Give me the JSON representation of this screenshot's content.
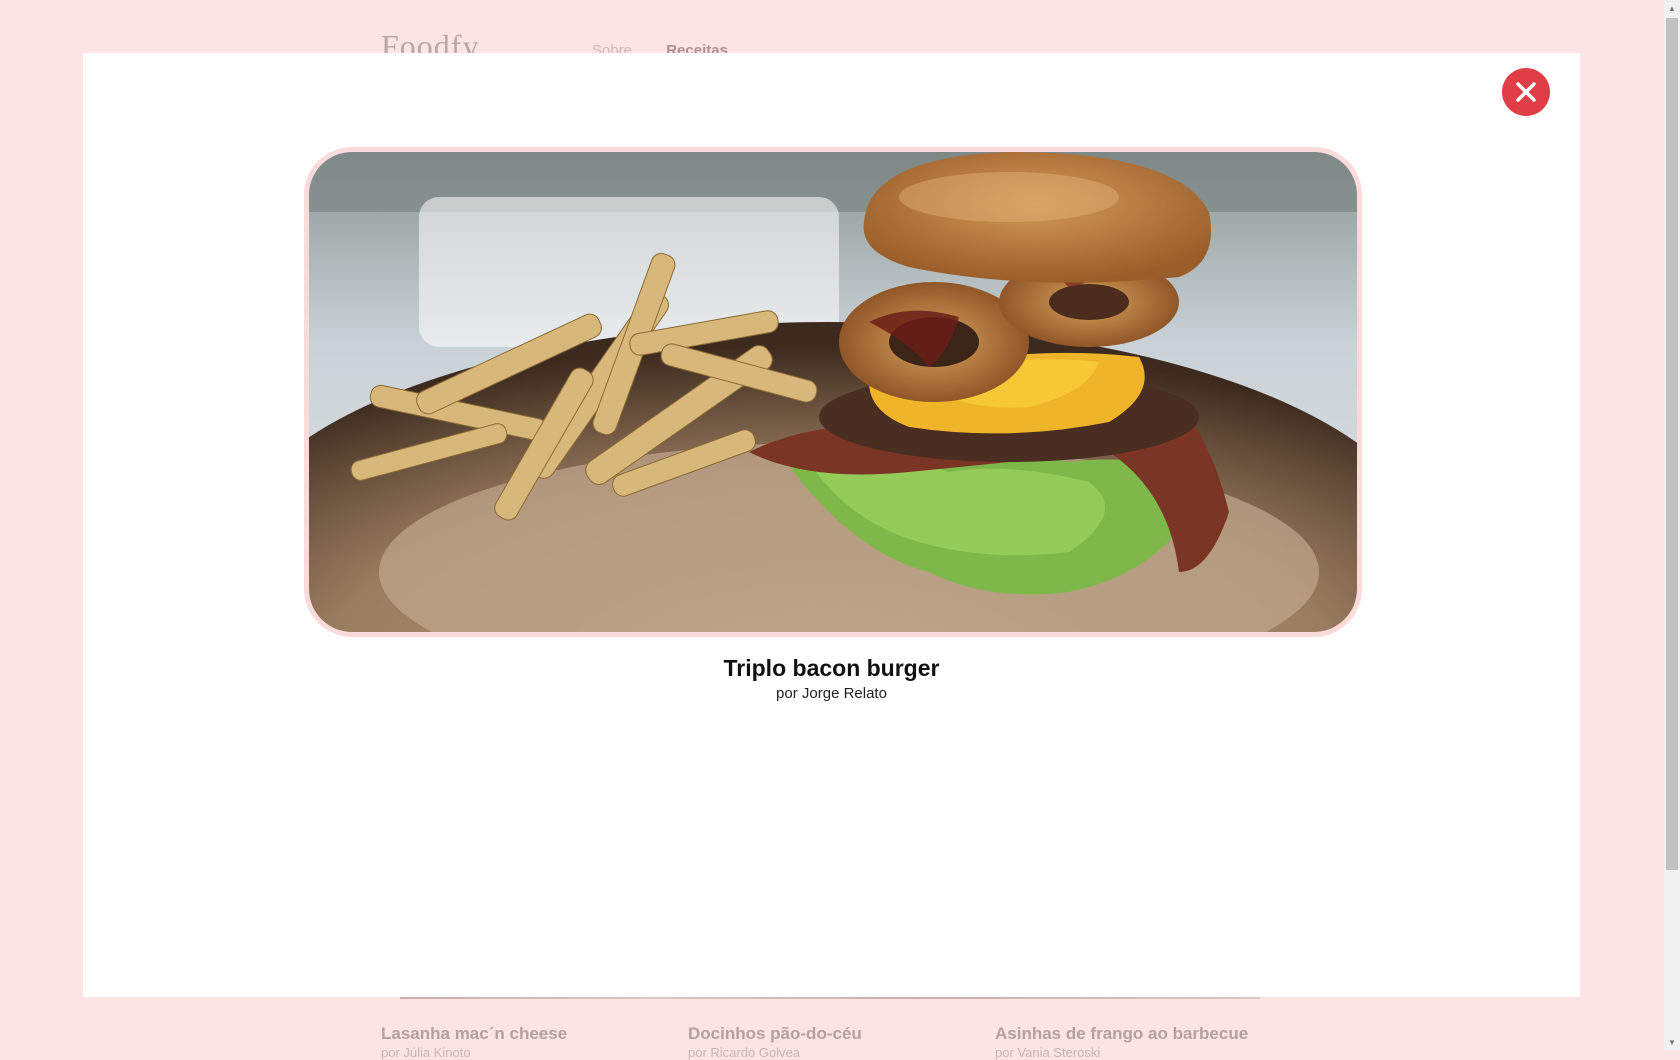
{
  "background": {
    "logo": "Foodfy",
    "nav": [
      "Sobre",
      "Receitas"
    ],
    "cards": [
      {
        "title": "Lasanha mac´n cheese",
        "author": "por Júlia Kinoto"
      },
      {
        "title": "Docinhos pão-do-céu",
        "author": "por Ricardo Golvea"
      },
      {
        "title": "Asinhas de frango ao barbecue",
        "author": "por Vania Steroski"
      }
    ]
  },
  "modal": {
    "close_icon": "close-x-icon",
    "image_alt": "Triplo bacon burger",
    "title": "Triplo bacon burger",
    "author": "por Jorge Relato"
  },
  "colors": {
    "page_bg": "#fde4e4",
    "close_button": "#e03d46",
    "image_border": "#fbdada"
  }
}
